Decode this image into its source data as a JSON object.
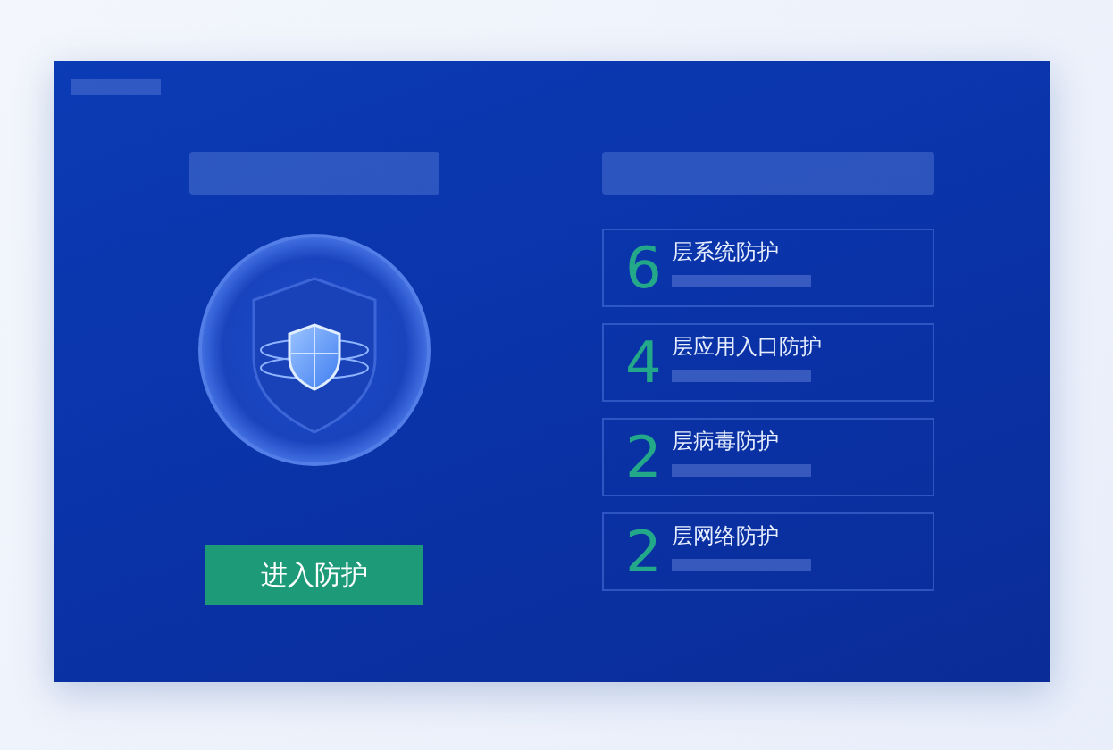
{
  "protection": {
    "button": "进入防护"
  },
  "layers": [
    {
      "count": "6",
      "label": "层系统防护"
    },
    {
      "count": "4",
      "label": "层应用入口防护"
    },
    {
      "count": "2",
      "label": "层病毒防护"
    },
    {
      "count": "2",
      "label": "层网络防护"
    }
  ]
}
